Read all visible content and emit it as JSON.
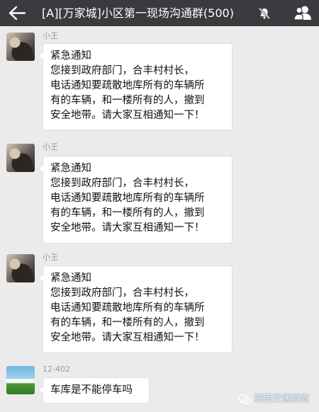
{
  "header": {
    "title": "[A][万家城]小区第一现场沟通群(500)",
    "back_icon": "back-arrow-icon",
    "mute_icon": "muted-bell-icon",
    "members_icon": "group-members-icon",
    "background": "#3a3a3f"
  },
  "messages": [
    {
      "sender": "小王",
      "lines": [
        "紧急通知",
        "  您接到政府部门，合丰村村长，",
        "电话通知要疏散地库所有的车辆所",
        "有的车辆，和一楼所有的人，撤到",
        "安全地带。请大家互相通知一下！"
      ]
    },
    {
      "sender": "小王",
      "lines": [
        "紧急通知",
        "  您接到政府部门，合丰村村长，",
        "电话通知要疏散地库所有的车辆所",
        "有的车辆，和一楼所有的人，撤到",
        "安全地带。请大家互相通知一下！"
      ]
    },
    {
      "sender": "小王",
      "lines": [
        "紧急通知",
        "  您接到政府部门，合丰村村长，",
        "电话通知要疏散地库所有的车辆所",
        "有的车辆，和一楼所有的人，撤到",
        "安全地带。请大家互相通知一下！"
      ]
    },
    {
      "sender": "12-402",
      "lines": [
        "车库是不能停车吗"
      ]
    }
  ],
  "watermark": {
    "text": "湖南交通频道",
    "logo_icon": "wechat-logo-icon"
  }
}
